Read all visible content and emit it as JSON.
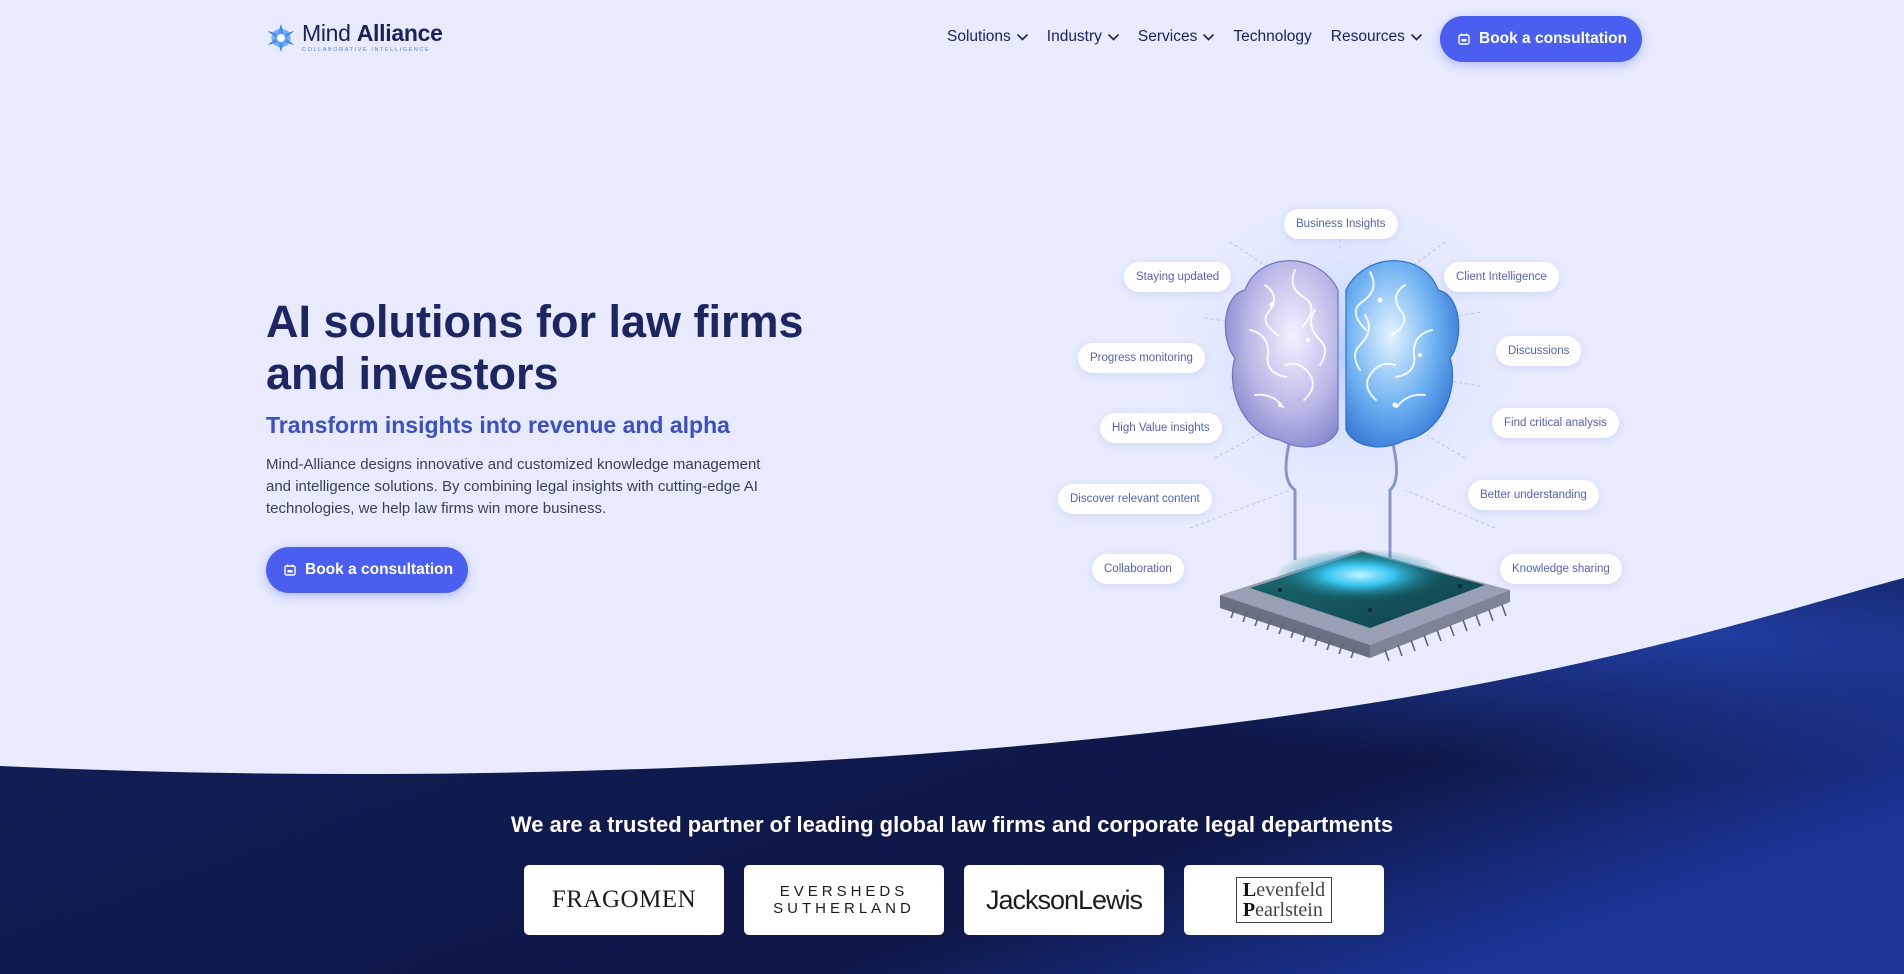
{
  "brand": {
    "name_light": "Mind ",
    "name_bold": "Alliance",
    "tagline": "COLLABORATIVE INTELLIGENCE"
  },
  "nav": {
    "items": [
      {
        "label": "Solutions",
        "has_dropdown": true
      },
      {
        "label": "Industry",
        "has_dropdown": true
      },
      {
        "label": "Services",
        "has_dropdown": true
      },
      {
        "label": "Technology",
        "has_dropdown": false
      },
      {
        "label": "Resources",
        "has_dropdown": true
      }
    ],
    "cta_label": "Book a consultation"
  },
  "hero": {
    "title": "AI solutions for law firms and investors",
    "subtitle": "Transform insights into revenue and alpha",
    "description": "Mind-Alliance designs innovative and customized knowledge management and intelligence solutions. By combining legal insights with cutting-edge AI technologies, we help law firms win more business.",
    "cta_label": "Book a consultation"
  },
  "illustration": {
    "pills": [
      "Business Insights",
      "Staying updated",
      "Client Intelligence",
      "Progress monitoring",
      "Discussions",
      "High Value insights",
      "Find critical analysis",
      "Discover relevant content",
      "Better understanding",
      "Collaboration",
      "Knowledge sharing"
    ]
  },
  "partners": {
    "heading": "We are a trusted partner of leading global law firms and corporate legal departments",
    "logos": {
      "fragomen": "FRAGOMEN",
      "eversheds_line1": "EVERSHEDS",
      "eversheds_line2": "SUTHERLAND",
      "jackson": "JacksonLewis",
      "lev_line1_initial": "L",
      "lev_line1_rest": "evenfeld",
      "lev_line2_initial": "P",
      "lev_line2_rest": "earlstein"
    }
  },
  "colors": {
    "background": "#e7ebfd",
    "accent": "#4a5ff0",
    "heading": "#1d2563",
    "subheading": "#3d4fc1",
    "dark_section": "#13194a"
  }
}
